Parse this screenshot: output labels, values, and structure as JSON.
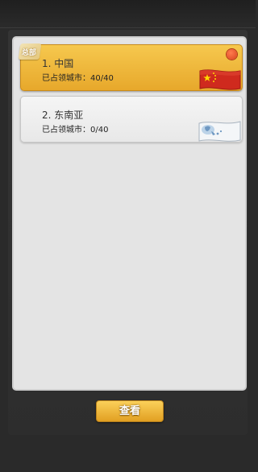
{
  "regions": [
    {
      "title": "1. 中国",
      "occupied": "已占领城市：40/40",
      "badge": "总部",
      "selected": true,
      "icon": "china-flag-icon"
    },
    {
      "title": "2. 东南亚",
      "occupied": "已占领城市：0/40",
      "selected": false,
      "icon": "southeast-asia-map-icon"
    }
  ],
  "view_button_label": "查看",
  "colors": {
    "selected_row": "#f3bc42",
    "normal_row": "#eeeeee",
    "button": "#f2b93f",
    "notification_dot": "#e2532b",
    "flag_red": "#cf2a1e"
  }
}
